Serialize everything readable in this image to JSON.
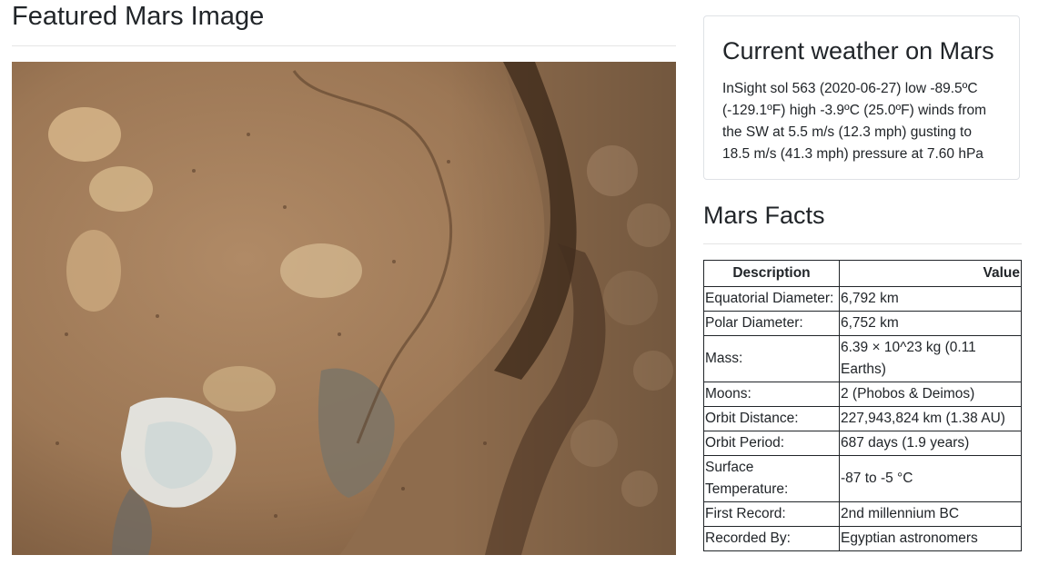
{
  "featured": {
    "title": "Featured Mars Image"
  },
  "weather": {
    "title": "Current weather on Mars",
    "text": "InSight sol 563 (2020-06-27) low -89.5ºC (-129.1ºF) high -3.9ºC (25.0ºF) winds from the SW at 5.5 m/s (12.3 mph) gusting to 18.5 m/s (41.3 mph) pressure at 7.60 hPa"
  },
  "facts": {
    "title": "Mars Facts",
    "headers": {
      "description": "Description",
      "value": "Value"
    },
    "rows": [
      {
        "description": "Equatorial Diameter:",
        "value": "6,792 km"
      },
      {
        "description": "Polar Diameter:",
        "value": "6,752 km"
      },
      {
        "description": "Mass:",
        "value": "6.39 × 10^23 kg (0.11 Earths)"
      },
      {
        "description": "Moons:",
        "value": "2 (Phobos & Deimos)"
      },
      {
        "description": "Orbit Distance:",
        "value": "227,943,824 km (1.38 AU)"
      },
      {
        "description": "Orbit Period:",
        "value": "687 days (1.9 years)"
      },
      {
        "description": "Surface Temperature:",
        "value": "-87 to -5 °C"
      },
      {
        "description": "First Record:",
        "value": "2nd millennium BC"
      },
      {
        "description": "Recorded By:",
        "value": "Egyptian astronomers"
      }
    ]
  }
}
